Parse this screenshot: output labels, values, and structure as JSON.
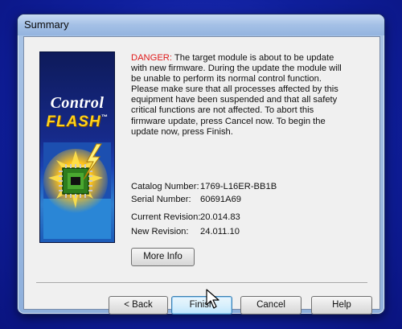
{
  "window": {
    "title": "Summary"
  },
  "logo": {
    "line1": "Control",
    "line2": "FLASH",
    "trademark": "™"
  },
  "message": {
    "danger_label": "DANGER:",
    "body": " The target module is about to be update with new firmware. During the update the module will be unable to perform its normal control function. Please make sure that all processes affected by this equipment have been suspended and that all safety critical functions are not affected. To abort this firmware update, press Cancel now. To begin the update now, press Finish."
  },
  "details": {
    "catalog_label": "Catalog Number:",
    "catalog_value": "1769-L16ER-BB1B",
    "serial_label": "Serial Number:",
    "serial_value": "60691A69",
    "current_label": "Current Revision:",
    "current_value": "20.014.83",
    "new_label": "New Revision:",
    "new_value": "24.011.10"
  },
  "buttons": {
    "more_info": "More Info",
    "back": "< Back",
    "finish": "Finish",
    "cancel": "Cancel",
    "help": "Help"
  },
  "colors": {
    "danger": "#e01b1b",
    "desktop": "#0f1f9c",
    "flash_text": "#ffd21a"
  },
  "icons": {
    "logo_art": "chip-lightning-icon",
    "cursor": "pointer-cursor-icon"
  }
}
